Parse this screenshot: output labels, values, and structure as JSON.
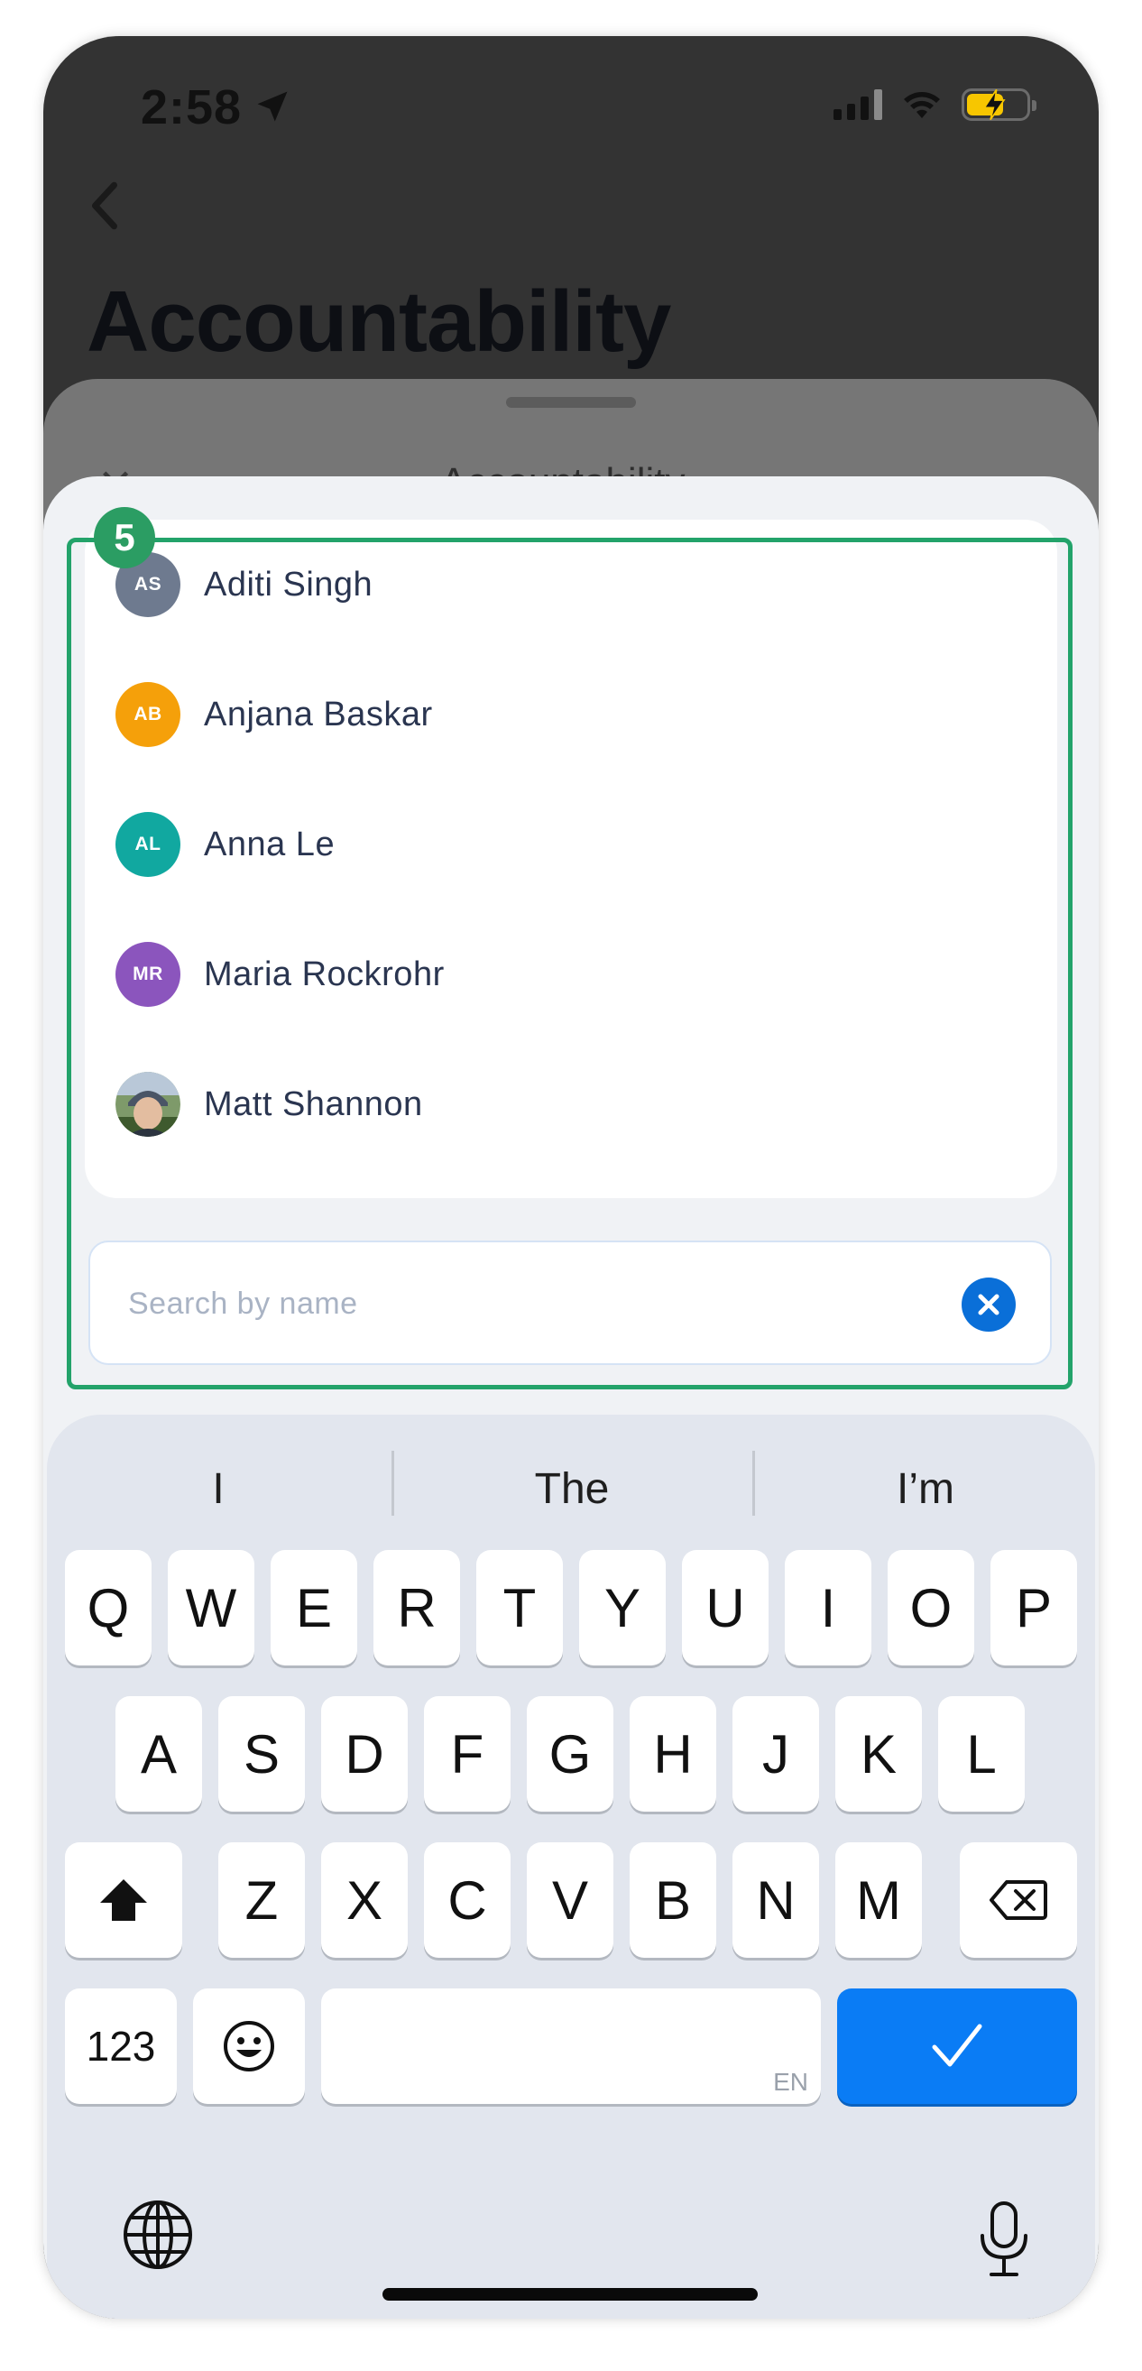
{
  "status_bar": {
    "time": "2:58"
  },
  "background": {
    "title": "Accountability"
  },
  "peek_sheet": {
    "title": "Accountability"
  },
  "annotation": {
    "step": "5"
  },
  "people": [
    {
      "initials": "AS",
      "name": "Aditi Singh",
      "color": "#6e7a8f"
    },
    {
      "initials": "AB",
      "name": "Anjana Baskar",
      "color": "#f5a00a"
    },
    {
      "initials": "AL",
      "name": "Anna Le",
      "color": "#11a8a0"
    },
    {
      "initials": "MR",
      "name": "Maria Rockrohr",
      "color": "#8b55bd"
    },
    {
      "initials": "",
      "name": "Matt Shannon",
      "color": "#5f7a55"
    }
  ],
  "search": {
    "placeholder": "Search by name"
  },
  "keyboard": {
    "suggestions": [
      "I",
      "The",
      "I’m"
    ],
    "row1": [
      "Q",
      "W",
      "E",
      "R",
      "T",
      "Y",
      "U",
      "I",
      "O",
      "P"
    ],
    "row2": [
      "A",
      "S",
      "D",
      "F",
      "G",
      "H",
      "J",
      "K",
      "L"
    ],
    "row3": [
      "Z",
      "X",
      "C",
      "V",
      "B",
      "N",
      "M"
    ],
    "numbers_key": "123",
    "space_language": "EN"
  }
}
